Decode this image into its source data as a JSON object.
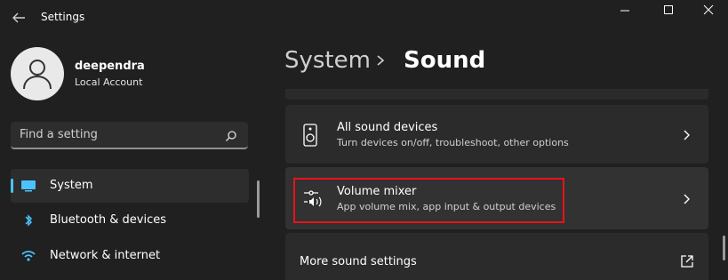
{
  "app": {
    "title": "Settings"
  },
  "window": {
    "minimize": "minimize",
    "maximize": "maximize",
    "close": "close"
  },
  "profile": {
    "name": "deependra",
    "account_type": "Local Account"
  },
  "search": {
    "placeholder": "Find a setting"
  },
  "nav": {
    "items": [
      {
        "label": "System",
        "icon": "monitor-icon",
        "active": true
      },
      {
        "label": "Bluetooth & devices",
        "icon": "bluetooth-icon",
        "active": false
      },
      {
        "label": "Network & internet",
        "icon": "wifi-icon",
        "active": false
      }
    ]
  },
  "breadcrumb": {
    "parent": "System",
    "current": "Sound"
  },
  "cards": [
    {
      "title": "All sound devices",
      "subtitle": "Turn devices on/off, troubleshoot, other options",
      "icon": "speaker-icon"
    },
    {
      "title": "Volume mixer",
      "subtitle": "App volume mix, app input & output devices",
      "icon": "volume-mixer-icon"
    },
    {
      "title": "More sound settings",
      "icon": "external-link-icon"
    }
  ],
  "colors": {
    "accent": "#4cc2ff",
    "highlight": "#e8131b",
    "background": "#202020",
    "card": "#2b2b2b"
  }
}
